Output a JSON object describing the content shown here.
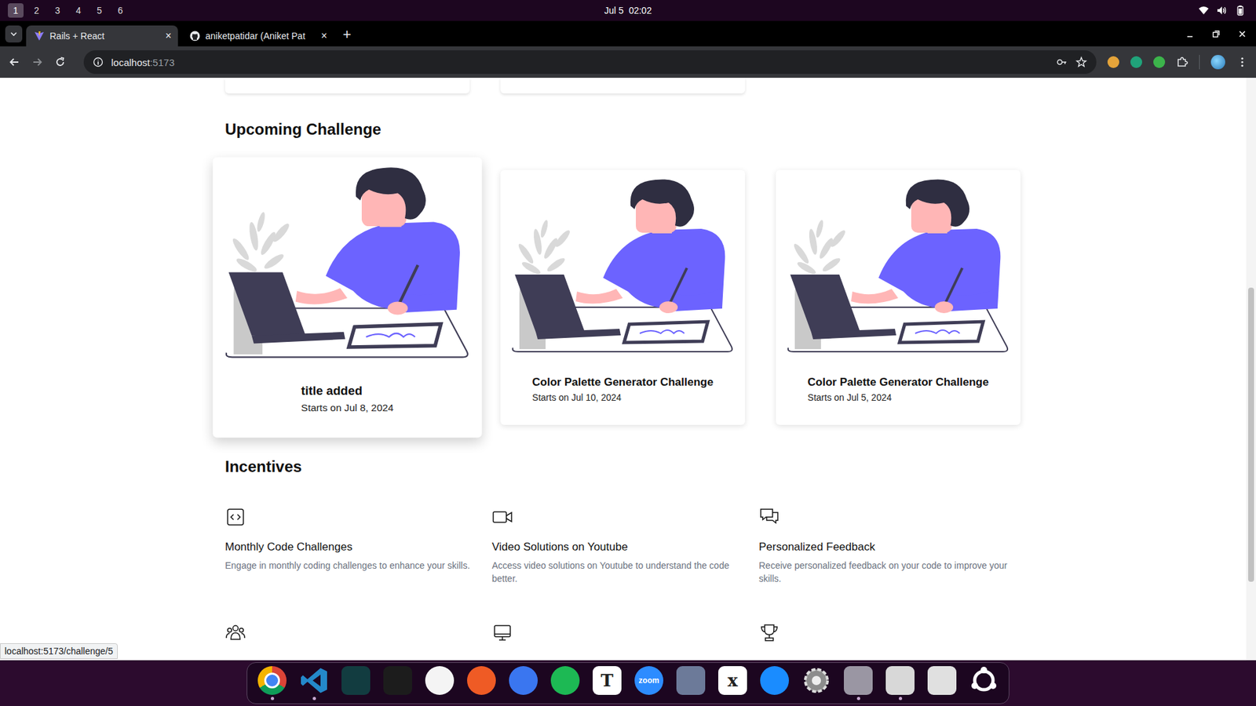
{
  "topbar": {
    "workspaces": [
      {
        "label": "1",
        "selected": true
      },
      {
        "label": "2",
        "selected": false
      },
      {
        "label": "3",
        "selected": false
      },
      {
        "label": "4",
        "selected": false
      },
      {
        "label": "5",
        "selected": false
      },
      {
        "label": "6",
        "selected": false
      }
    ],
    "clock": "Jul 5  02:02"
  },
  "browser": {
    "tabs": [
      {
        "label": "Rails + React",
        "selected": true,
        "kind": "vite",
        "close": "×"
      },
      {
        "label": "aniketpatidar (Aniket Pat",
        "selected": false,
        "kind": "github",
        "close": "×"
      }
    ],
    "new_tab": "+",
    "url": {
      "host": "localhost",
      "port": ":5173"
    },
    "extensions": [
      {
        "color": "#e5a43a"
      },
      {
        "color": "#20a37a"
      },
      {
        "color": "#3cb44b"
      }
    ],
    "status_bubble": "localhost:5173/challenge/5"
  },
  "page": {
    "upcoming_heading": "Upcoming Challenge",
    "challenges": [
      {
        "title": "title added",
        "date": "Starts on Jul 8, 2024",
        "hovered": true
      },
      {
        "title": "Color Palette Generator Challenge",
        "date": "Starts on Jul 10, 2024",
        "hovered": false
      },
      {
        "title": "Color Palette Generator Challenge",
        "date": "Starts on Jul 5, 2024",
        "hovered": false
      }
    ],
    "incentives_heading": "Incentives",
    "incentives": [
      {
        "kind": "code",
        "title": "Monthly Code Challenges",
        "description": "Engage in monthly coding challenges to enhance your skills."
      },
      {
        "kind": "video",
        "title": "Video Solutions on Youtube",
        "description": "Access video solutions on Youtube to understand the code better."
      },
      {
        "kind": "chat",
        "title": "Personalized Feedback",
        "description": "Receive personalized feedback on your code to improve your skills."
      }
    ],
    "more_incentives": [
      {
        "kind": "community"
      },
      {
        "kind": "monitor"
      },
      {
        "kind": "trophy"
      }
    ]
  },
  "dock": [
    {
      "kind": "chrome",
      "color": "#4285f4",
      "label": "",
      "running": true
    },
    {
      "kind": "vscode",
      "color": "#2489ca",
      "label": "",
      "running": true
    },
    {
      "kind": "tile",
      "color": "#123c40",
      "label": "",
      "running": false
    },
    {
      "kind": "tile",
      "color": "#1c1c1c",
      "label": "",
      "running": false
    },
    {
      "kind": "circle",
      "color": "#f4f4f4",
      "label": "",
      "running": false
    },
    {
      "kind": "circle",
      "color": "#ef5b25",
      "label": "",
      "running": false
    },
    {
      "kind": "circle",
      "color": "#3a76f0",
      "label": "",
      "running": false
    },
    {
      "kind": "circle",
      "color": "#1db954",
      "label": "",
      "running": false
    },
    {
      "kind": "tile",
      "color": "#ffffff",
      "label": "T",
      "running": false
    },
    {
      "kind": "circle",
      "color": "#2d8cff",
      "label": "zoom",
      "running": false
    },
    {
      "kind": "tile",
      "color": "#6c7a99",
      "label": "",
      "running": false
    },
    {
      "kind": "tile",
      "color": "#ffffff",
      "label": "x",
      "running": false
    },
    {
      "kind": "circle",
      "color": "#1a8cff",
      "label": "",
      "running": false
    },
    {
      "kind": "gear",
      "color": "#8c8c8c",
      "label": "",
      "running": false
    },
    {
      "kind": "tile",
      "color": "#9a96a3",
      "label": "",
      "running": true
    },
    {
      "kind": "tile",
      "color": "#d8d8d8",
      "label": "",
      "running": true
    },
    {
      "kind": "tile",
      "color": "#e0e0e0",
      "label": "",
      "running": false
    },
    {
      "kind": "ubuntu",
      "color": "#ffffff",
      "label": "",
      "running": false
    }
  ]
}
